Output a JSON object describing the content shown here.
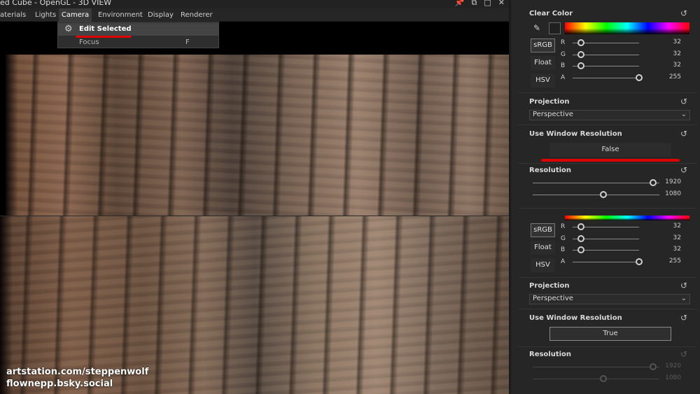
{
  "window": {
    "title": "ed Cube - OpenGL - 3D VIEW",
    "icons": [
      "pin-icon",
      "restore-icon",
      "maximize-icon",
      "close-icon"
    ]
  },
  "menu": {
    "items": [
      "aterials",
      "Lights",
      "Camera",
      "Environment",
      "Display",
      "Renderer"
    ],
    "active": "Camera"
  },
  "dropdown": {
    "items": [
      {
        "label": "Edit Selected",
        "shortcut": "",
        "icon": "gear-icon",
        "highlighted": true
      },
      {
        "label": "Focus",
        "shortcut": "F",
        "highlighted": false
      }
    ]
  },
  "watermark": {
    "line1": "artstation.com/steppenwolf",
    "line2": "flownepp.bsky.social"
  },
  "panel": {
    "clear_color": {
      "label": "Clear Color",
      "swatch_color": "#202020",
      "modes": [
        "sRGB",
        "Float",
        "HSV"
      ],
      "active_mode": "sRGB"
    },
    "channels_top": [
      {
        "label": "R",
        "value": "32",
        "fraction": 0.125
      },
      {
        "label": "G",
        "value": "32",
        "fraction": 0.125
      },
      {
        "label": "B",
        "value": "32",
        "fraction": 0.125
      },
      {
        "label": "A",
        "value": "255",
        "fraction": 1.0
      }
    ],
    "projection_top": {
      "label": "Projection",
      "value": "Perspective"
    },
    "use_window_resolution_top": {
      "label": "Use Window Resolution",
      "value": "False"
    },
    "resolution_top": {
      "label": "Resolution",
      "width": "1920",
      "height": "1080",
      "width_fraction": 0.95,
      "height_fraction": 0.56
    },
    "channels_bottom": [
      {
        "label": "R",
        "value": "32",
        "fraction": 0.125
      },
      {
        "label": "G",
        "value": "32",
        "fraction": 0.125
      },
      {
        "label": "B",
        "value": "32",
        "fraction": 0.125
      },
      {
        "label": "A",
        "value": "255",
        "fraction": 1.0
      }
    ],
    "modes_bottom": [
      "sRGB",
      "Float",
      "HSV"
    ],
    "projection_bottom": {
      "label": "Projection",
      "value": "Perspective"
    },
    "use_window_resolution_bottom": {
      "label": "Use Window Resolution",
      "value": "True"
    },
    "resolution_bottom": {
      "label": "Resolution",
      "width": "1920",
      "height": "1080",
      "width_fraction": 0.95,
      "height_fraction": 0.56,
      "disabled": true
    }
  },
  "colors": {
    "accent_highlight": "#e00000",
    "panel_bg": "#262626",
    "text": "#d9d9d9"
  }
}
